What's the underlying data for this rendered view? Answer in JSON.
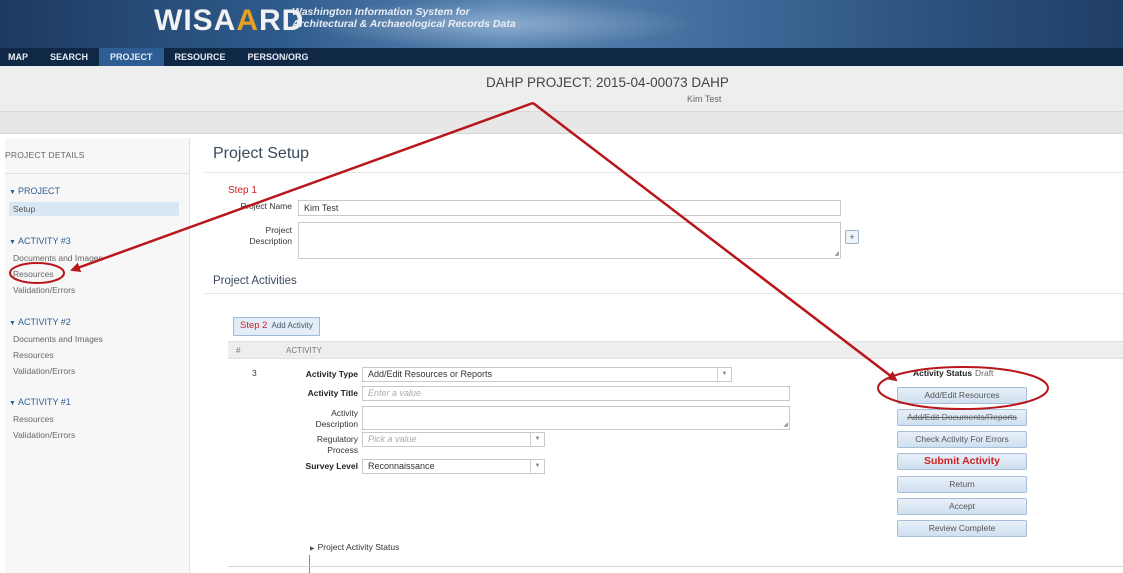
{
  "banner": {
    "logo_text": "WISA",
    "logo_accent": "A",
    "logo_tail": "RD",
    "tagline_line1": "Washington Information System for",
    "tagline_line2": "Architectural & Archaeological Records Data"
  },
  "nav": {
    "items": [
      "MAP",
      "SEARCH",
      "PROJECT",
      "RESOURCE",
      "PERSON/ORG"
    ],
    "active": "PROJECT"
  },
  "project": {
    "title": "DAHP PROJECT: 2015-04-00073 DAHP",
    "subtitle": "Kim Test"
  },
  "sidebar": {
    "heading": "PROJECT DETAILS",
    "sections": [
      {
        "label": "PROJECT",
        "items": [
          "Setup"
        ]
      },
      {
        "label": "ACTIVITY #3",
        "items": [
          "Documents and Images",
          "Resources",
          "Validation/Errors"
        ]
      },
      {
        "label": "ACTIVITY #2",
        "items": [
          "Documents and Images",
          "Resources",
          "Validation/Errors"
        ]
      },
      {
        "label": "ACTIVITY #1",
        "items": [
          "Resources",
          "Validation/Errors"
        ]
      }
    ]
  },
  "main": {
    "title": "Project Setup",
    "step1": "Step 1",
    "project_name_label": "Project Name",
    "project_name_value": "Kim Test",
    "project_desc_label_1": "Project",
    "project_desc_label_2": "Description",
    "plus": "+",
    "activities_title": "Project Activities",
    "step2": "Step 2",
    "add_activity": "Add Activity",
    "col_num": "#",
    "col_activity": "ACTIVITY",
    "row_num": "3",
    "activity_type_label": "Activity Type",
    "activity_type_value": "Add/Edit Resources or Reports",
    "activity_title_label": "Activity Title",
    "activity_title_placeholder": "Enter a value",
    "activity_desc_label_1": "Activity",
    "activity_desc_label_2": "Description",
    "regulatory_label_1": "Regulatory",
    "regulatory_label_2": "Process",
    "regulatory_placeholder": "Pick a value",
    "survey_label": "Survey Level",
    "survey_value": "Reconnaissance",
    "project_activity_status": "Project Activity Status"
  },
  "status": {
    "label": "Activity Status",
    "value": "Draft",
    "buttons": {
      "add_edit_resources": "Add/Edit Resources",
      "add_edit_docs": "Add/Edit Documents/Reports",
      "check_errors": "Check Activity For Errors",
      "submit": "Submit Activity",
      "return": "Return",
      "accept": "Accept",
      "review_complete": "Review Complete"
    }
  },
  "colors": {
    "accent_red": "#cc2222",
    "nav_bg": "#0f2845",
    "annotation_red": "#b8161b"
  }
}
